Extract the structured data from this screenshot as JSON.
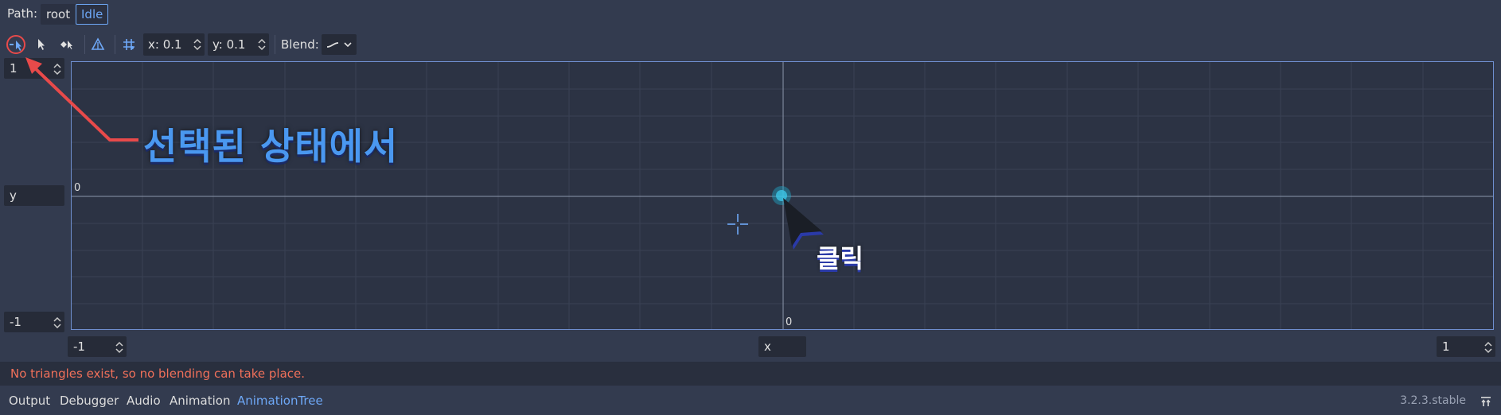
{
  "path_bar": {
    "label": "Path:",
    "crumbs": [
      "root",
      "Idle"
    ]
  },
  "toolbar": {
    "snap_x": "x: 0.1",
    "snap_y": "y: 0.1",
    "blend_label": "Blend:"
  },
  "axes": {
    "y_max": "1",
    "y_label": "y",
    "y_min": "-1",
    "x_min": "-1",
    "x_label": "x",
    "x_max": "1",
    "origin_y_label": "0",
    "origin_x_label": "0"
  },
  "error": "No triangles exist, so no blending can take place.",
  "bottom_tabs": [
    "Output",
    "Debugger",
    "Audio",
    "Animation",
    "AnimationTree"
  ],
  "active_tab": "AnimationTree",
  "version": "3.2.3.stable",
  "annotations": {
    "selected_state": "선택된 상태에서",
    "click": "클릭"
  },
  "colors": {
    "accent": "#6ea8f7",
    "error": "#f0705a",
    "annotation_arrow": "#e84a4a",
    "annotation_text": "#4a98f0"
  }
}
